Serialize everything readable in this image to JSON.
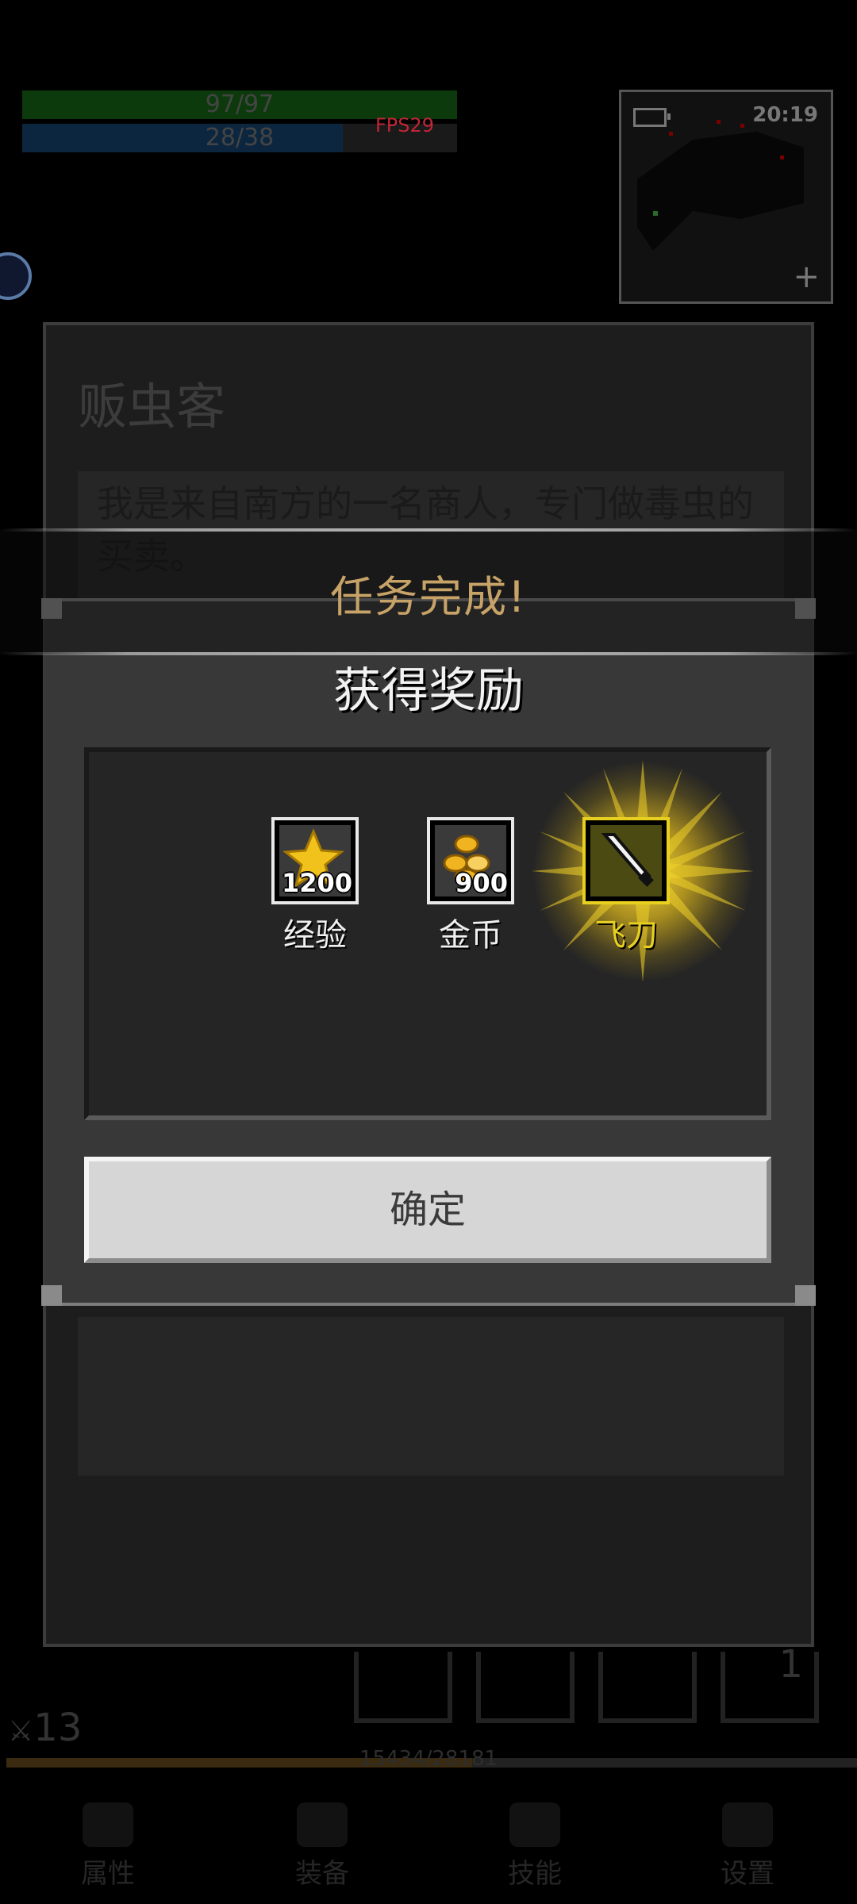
{
  "hud": {
    "hp_text": "97/97",
    "hp_fraction": 1.0,
    "mp_text": "28/38",
    "mp_fraction": 0.7368,
    "fps": "FPS29",
    "clock": "20:19",
    "colors": {
      "hp": "#0d3a0d",
      "mp": "#0d2640",
      "fps": "#c02636"
    }
  },
  "merchant": {
    "name": "贩虫客",
    "dialog_text": "我是来自南方的一名商人，专门做毒虫的买卖。"
  },
  "quest_popup": {
    "title": "任务完成!",
    "subtitle": "获得奖励",
    "rewards": [
      {
        "label": "经验",
        "count": "1200",
        "icon": "star-icon"
      },
      {
        "label": "金币",
        "count": "900",
        "icon": "gold-coins-icon"
      },
      {
        "label": "飞刀",
        "count": "",
        "icon": "throwing-knife-icon",
        "highlighted": true
      }
    ],
    "confirm_label": "确定",
    "colors": {
      "title": "#c8a368",
      "highlight": "#e8d020"
    }
  },
  "bottom": {
    "quickslot_count": "1",
    "level": "13",
    "xp_text": "15434/28181",
    "xp_fraction": 0.5477,
    "nav": [
      {
        "label": "属性",
        "icon": "helmet-icon"
      },
      {
        "label": "装备",
        "icon": "bag-icon"
      },
      {
        "label": "技能",
        "icon": "crystal-icon"
      },
      {
        "label": "设置",
        "icon": "gear-icon"
      }
    ]
  }
}
